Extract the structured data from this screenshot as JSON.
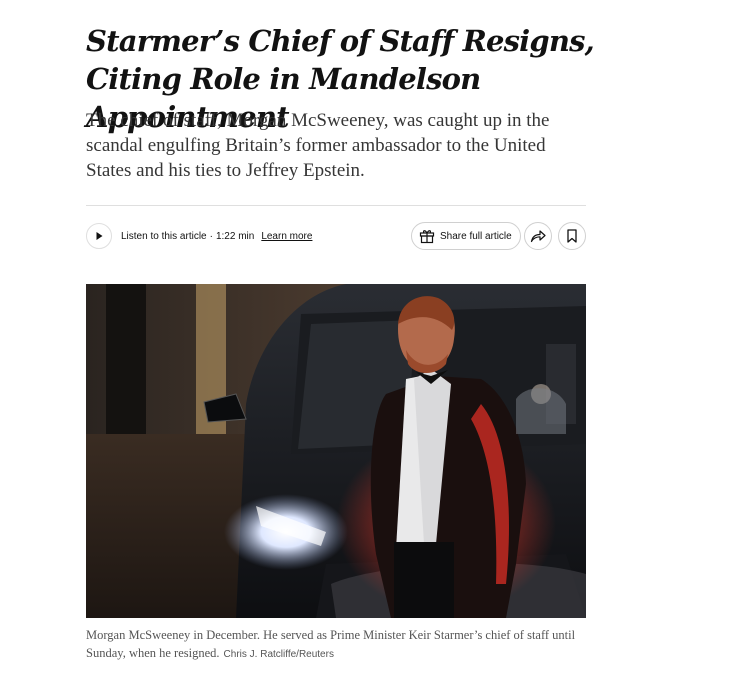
{
  "article": {
    "headline": "Starmer’s Chief of Staff Resigns, Citing Role in Mandelson Appointment",
    "summary": "The chief of staff, Morgan McSweeney, was caught up in the scandal engulfing Britain’s former ambassador to the United States and his ties to Jeffrey Epstein."
  },
  "toolbar": {
    "listen_label": "Listen to this article",
    "separator": "·",
    "duration": "1:22 min",
    "learn_more": "Learn more",
    "share_label": "Share full article",
    "icons": {
      "play": "play-icon",
      "gift": "gift-icon",
      "share": "share-arrow-icon",
      "bookmark": "bookmark-icon"
    }
  },
  "photo": {
    "caption": "Morgan McSweeney in December. He served as Prime Minister Keir Starmer’s chief of staff until Sunday, when he resigned.",
    "credit": "Chris J. Ratcliffe/Reuters"
  }
}
